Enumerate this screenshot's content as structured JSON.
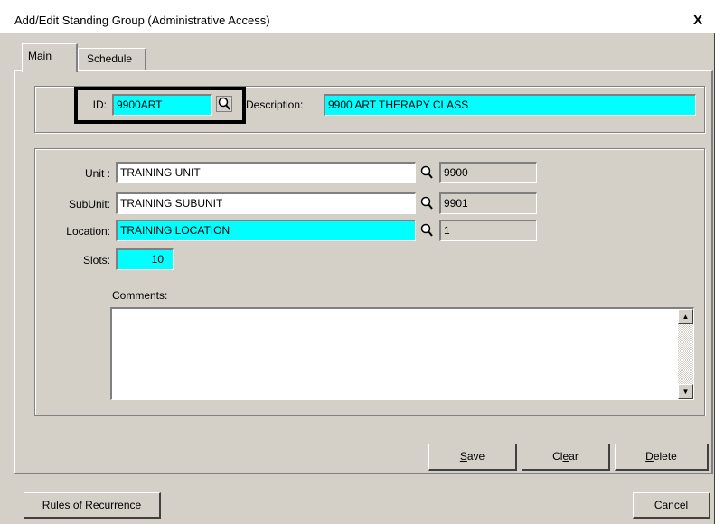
{
  "window": {
    "title": "Add/Edit Standing Group (Administrative Access)",
    "close_glyph": "X"
  },
  "tabs": [
    {
      "label": "Main",
      "active": true
    },
    {
      "label": "Schedule",
      "active": false
    }
  ],
  "header": {
    "id_label": "ID:",
    "id_value": "9900ART",
    "description_label": "Description:",
    "description_value": "9900 ART THERAPY CLASS"
  },
  "details": {
    "unit": {
      "label": "Unit :",
      "value": "TRAINING UNIT",
      "code": "9900"
    },
    "subunit": {
      "label": "SubUnit:",
      "value": "TRAINING SUBUNIT",
      "code": "9901"
    },
    "location": {
      "label": "Location:",
      "value": "TRAINING LOCATION",
      "code": "1"
    },
    "slots": {
      "label": "Slots:",
      "value": "10"
    },
    "comments": {
      "label": "Comments:",
      "value": ""
    }
  },
  "buttons": {
    "save": {
      "first": "S",
      "rest": "ave"
    },
    "clear": {
      "pre": "Cl",
      "key": "e",
      "post": "ar"
    },
    "delete": {
      "first": "D",
      "rest": "elete"
    },
    "rules": {
      "first": "R",
      "rest": "ules of Recurrence"
    },
    "cancel": {
      "pre": "Ca",
      "key": "n",
      "post": "cel"
    }
  },
  "icons": {
    "lookup": "magnifier-icon",
    "scroll_up": "scroll-up-arrow-icon",
    "scroll_down": "scroll-down-arrow-icon",
    "close": "close-icon"
  },
  "colors": {
    "field_highlight": "#00ffff",
    "dialog_face": "#d4d0c8",
    "callout_border": "#000000"
  }
}
